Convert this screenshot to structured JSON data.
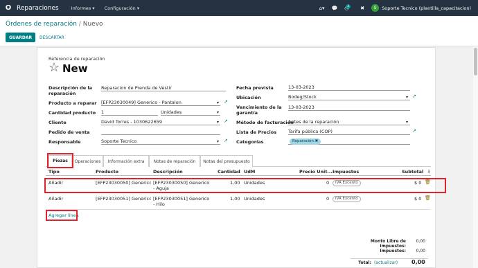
{
  "navbar": {
    "logo": "O",
    "app_name": "Reparaciones",
    "menus": [
      "Informes ▾",
      "Configuración ▾"
    ],
    "chat_badge": "3",
    "user_initial": "S",
    "user_name": "Soporte Tecnico (plantilla_capacitacion)"
  },
  "breadcrumb": {
    "parent": "Órdenes de reparación",
    "sep": "/",
    "current": "Nuevo"
  },
  "actions": {
    "save": "GUARDAR",
    "discard": "DESCARTAR"
  },
  "header": {
    "ref_label": "Referencia de reparación",
    "name": "New"
  },
  "left_fields": [
    {
      "label": "Descripción de la reparación",
      "value": "Reparacion de Prenda de Vestir"
    },
    {
      "label": "Producto a reparar",
      "value": "[EFP23030049] Generico - Pantalon"
    },
    {
      "label": "Cantidad producto",
      "value": "1",
      "uom": "Unidades"
    },
    {
      "label": "Cliente",
      "value": "David Torres - 1030622659"
    },
    {
      "label": "Pedido de venta",
      "value": ""
    },
    {
      "label": "Responsable",
      "value": "Soporte Tecnico"
    }
  ],
  "right_fields": [
    {
      "label": "Fecha prevista",
      "value": "13-03-2023"
    },
    {
      "label": "Ubicación",
      "value": "Bodeg/Stock"
    },
    {
      "label": "Vencimiento de la garantía",
      "value": "13-03-2023"
    },
    {
      "label": "Método de facturación",
      "value": "Antes de la reparación"
    },
    {
      "label": "Lista de Precios",
      "value": "Tarifa pública (COP)"
    },
    {
      "label": "Categorías",
      "value": "Reparación ✖"
    }
  ],
  "tabs": [
    "Piezas",
    "Operaciones",
    "Información extra",
    "Notas de reparación",
    "Notas del presupuesto"
  ],
  "table": {
    "headers": [
      "Tipo",
      "Producto",
      "Descripción",
      "Cantidad",
      "UdM",
      "Precio Unit...",
      "Impuestos",
      "Subtotal"
    ],
    "rows": [
      {
        "tipo": "Añadir",
        "producto": "[EFP23030050] Generico ...",
        "descripcion": "[EFP23030050] Generico - Aguja",
        "cantidad": "1,00",
        "udm": "Unidades",
        "precio": "0",
        "impuesto": "IVA Excento",
        "subtotal": "$ 0"
      },
      {
        "tipo": "Añadir",
        "producto": "[EFP23030051] Generico ...",
        "descripcion": "[EFP23030051] Generico - Hilo",
        "cantidad": "1,00",
        "udm": "Unidades",
        "precio": "0",
        "impuesto": "IVA Excento",
        "subtotal": "$ 0"
      }
    ],
    "add_line": "Agregar línea"
  },
  "totals": {
    "untaxed_label": "Monto Libre de Impuestos:",
    "untaxed_value": "0,00",
    "taxes_label": "Impuestos:",
    "taxes_value": "0,00",
    "total_label": "Total:",
    "recompute": "(actualizar)",
    "total_value": "0,00"
  }
}
